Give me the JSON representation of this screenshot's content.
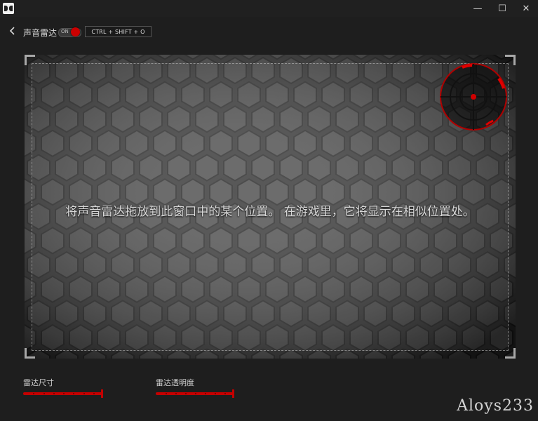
{
  "window": {
    "minimize_glyph": "—",
    "maximize_glyph": "☐",
    "close_glyph": "✕"
  },
  "header": {
    "title": "声音雷达",
    "toggle_label": "ON",
    "toggle_on": true,
    "hotkey": "CTRL + SHIFT + O"
  },
  "stage": {
    "instruction": "将声音雷达拖放到此窗口中的某个位置。 在游戏里，它将显示在相似位置处。"
  },
  "sliders": [
    {
      "label": "雷达尺寸",
      "value": 1.0
    },
    {
      "label": "雷达透明度",
      "value": 1.0
    }
  ],
  "watermark": "Aloys233",
  "colors": {
    "accent": "#c40000",
    "background": "#1e1e1e"
  }
}
